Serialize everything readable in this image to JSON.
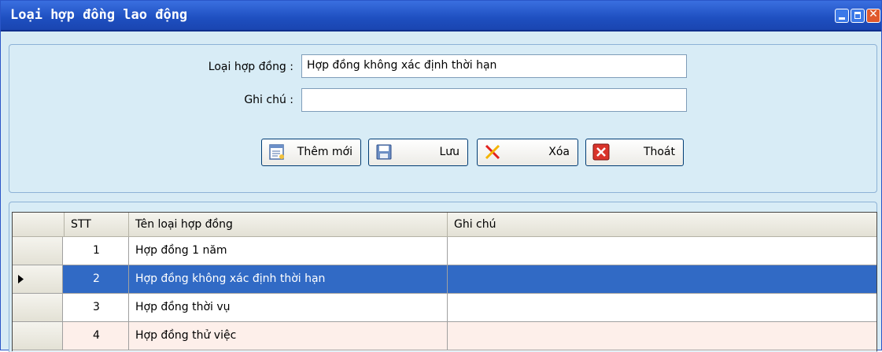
{
  "window": {
    "title": "Loại hợp đồng lao động",
    "accent": "#1e4fc0"
  },
  "form": {
    "contract_type_label": "Loại hợp đồng :",
    "contract_type_value": "Hợp đồng không xác định thời hạn",
    "note_label": "Ghi chú :",
    "note_value": ""
  },
  "buttons": {
    "add_label": "Thêm mới",
    "save_label": "Lưu",
    "delete_label": "Xóa",
    "exit_label": "Thoát"
  },
  "grid": {
    "columns": [
      "STT",
      "Tên loại hợp đồng",
      "Ghi chú"
    ],
    "rows": [
      {
        "stt": "1",
        "name": "Hợp đồng 1 năm",
        "note": ""
      },
      {
        "stt": "2",
        "name": "Hợp đồng không xác định thời hạn",
        "note": "",
        "selected": true
      },
      {
        "stt": "3",
        "name": "Hợp đồng thời vụ",
        "note": ""
      },
      {
        "stt": "4",
        "name": "Hợp đồng thử việc",
        "note": ""
      }
    ],
    "selection_color": "#316ac5"
  }
}
